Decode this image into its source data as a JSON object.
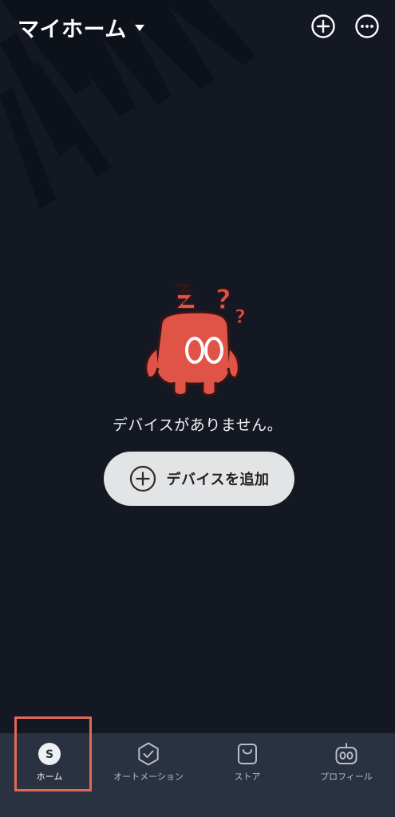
{
  "header": {
    "title": "マイホーム"
  },
  "empty_state": {
    "message": "デバイスがありません。",
    "add_device_label": "デバイスを追加"
  },
  "bottom_nav": {
    "items": [
      {
        "label": "ホーム",
        "icon": "home-s-icon",
        "active": true
      },
      {
        "label": "オートメーション",
        "icon": "automation-check-icon",
        "active": false
      },
      {
        "label": "ストア",
        "icon": "store-bag-icon",
        "active": false
      },
      {
        "label": "プロフィール",
        "icon": "profile-robot-icon",
        "active": false
      }
    ],
    "home_badge": "S"
  },
  "colors": {
    "background": "#131822",
    "nav_background": "#2a3140",
    "button_background": "#e3e4e6",
    "mascot_red": "#e05448",
    "highlight": "#df6a57"
  }
}
